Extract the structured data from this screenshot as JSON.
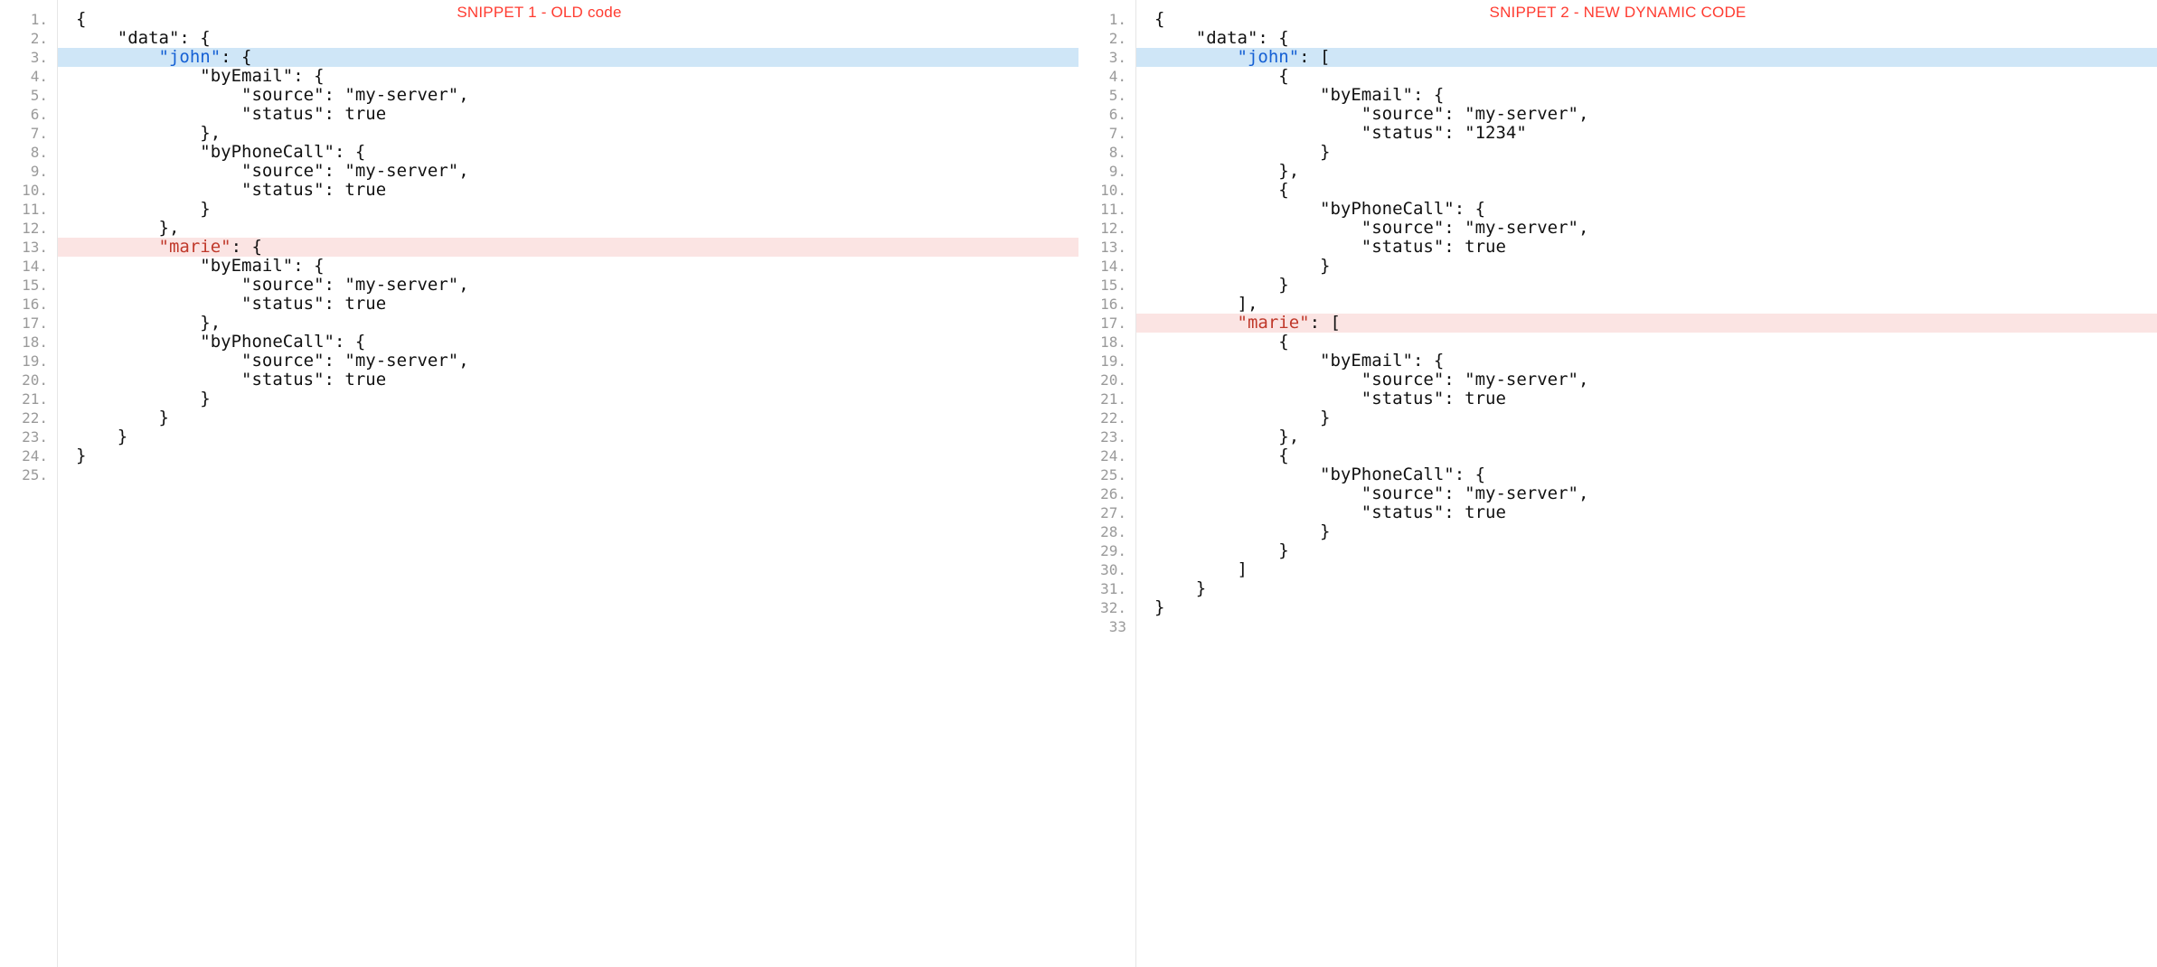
{
  "left": {
    "title": "SNIPPET 1 - OLD code",
    "lines": [
      {
        "n": "1.",
        "hl": "",
        "segs": [
          {
            "cls": "",
            "t": "{"
          }
        ]
      },
      {
        "n": "2.",
        "hl": "",
        "segs": [
          {
            "cls": "",
            "t": "    \"data\": {"
          }
        ]
      },
      {
        "n": "3.",
        "hl": "blue",
        "segs": [
          {
            "cls": "",
            "t": "        "
          },
          {
            "cls": "tok-key-blue",
            "t": "\"john\""
          },
          {
            "cls": "",
            "t": ": {"
          }
        ]
      },
      {
        "n": "4.",
        "hl": "",
        "segs": [
          {
            "cls": "",
            "t": "            \"byEmail\": {"
          }
        ]
      },
      {
        "n": "5.",
        "hl": "",
        "segs": [
          {
            "cls": "",
            "t": "                \"source\": \"my-server\","
          }
        ]
      },
      {
        "n": "6.",
        "hl": "",
        "segs": [
          {
            "cls": "",
            "t": "                \"status\": true"
          }
        ]
      },
      {
        "n": "7.",
        "hl": "",
        "segs": [
          {
            "cls": "",
            "t": "            },"
          }
        ]
      },
      {
        "n": "8.",
        "hl": "",
        "segs": [
          {
            "cls": "",
            "t": "            \"byPhoneCall\": {"
          }
        ]
      },
      {
        "n": "9.",
        "hl": "",
        "segs": [
          {
            "cls": "",
            "t": "                \"source\": \"my-server\","
          }
        ]
      },
      {
        "n": "10.",
        "hl": "",
        "segs": [
          {
            "cls": "",
            "t": "                \"status\": true"
          }
        ]
      },
      {
        "n": "11.",
        "hl": "",
        "segs": [
          {
            "cls": "",
            "t": "            }"
          }
        ]
      },
      {
        "n": "12.",
        "hl": "",
        "segs": [
          {
            "cls": "",
            "t": "        },"
          }
        ]
      },
      {
        "n": "13.",
        "hl": "pink",
        "segs": [
          {
            "cls": "",
            "t": "        "
          },
          {
            "cls": "tok-key-red",
            "t": "\"marie\""
          },
          {
            "cls": "",
            "t": ": {"
          }
        ]
      },
      {
        "n": "14.",
        "hl": "",
        "segs": [
          {
            "cls": "",
            "t": "            \"byEmail\": {"
          }
        ]
      },
      {
        "n": "15.",
        "hl": "",
        "segs": [
          {
            "cls": "",
            "t": "                \"source\": \"my-server\","
          }
        ]
      },
      {
        "n": "16.",
        "hl": "",
        "segs": [
          {
            "cls": "",
            "t": "                \"status\": true"
          }
        ]
      },
      {
        "n": "17.",
        "hl": "",
        "segs": [
          {
            "cls": "",
            "t": "            },"
          }
        ]
      },
      {
        "n": "18.",
        "hl": "",
        "segs": [
          {
            "cls": "",
            "t": "            \"byPhoneCall\": {"
          }
        ]
      },
      {
        "n": "19.",
        "hl": "",
        "segs": [
          {
            "cls": "",
            "t": "                \"source\": \"my-server\","
          }
        ]
      },
      {
        "n": "20.",
        "hl": "",
        "segs": [
          {
            "cls": "",
            "t": "                \"status\": true"
          }
        ]
      },
      {
        "n": "21.",
        "hl": "",
        "segs": [
          {
            "cls": "",
            "t": "            }"
          }
        ]
      },
      {
        "n": "22.",
        "hl": "",
        "segs": [
          {
            "cls": "",
            "t": "        }"
          }
        ]
      },
      {
        "n": "23.",
        "hl": "",
        "segs": [
          {
            "cls": "",
            "t": "    }"
          }
        ]
      },
      {
        "n": "24.",
        "hl": "",
        "segs": [
          {
            "cls": "",
            "t": "}"
          }
        ]
      },
      {
        "n": "25.",
        "hl": "",
        "segs": [
          {
            "cls": "",
            "t": ""
          }
        ]
      }
    ]
  },
  "right": {
    "title": "SNIPPET 2 - NEW DYNAMIC CODE",
    "lines": [
      {
        "n": "1.",
        "hl": "",
        "segs": [
          {
            "cls": "",
            "t": "{"
          }
        ]
      },
      {
        "n": "2.",
        "hl": "",
        "segs": [
          {
            "cls": "",
            "t": "    \"data\": {"
          }
        ]
      },
      {
        "n": "3.",
        "hl": "blue",
        "segs": [
          {
            "cls": "",
            "t": "        "
          },
          {
            "cls": "tok-key-blue",
            "t": "\"john\""
          },
          {
            "cls": "",
            "t": ": ["
          }
        ]
      },
      {
        "n": "4.",
        "hl": "",
        "segs": [
          {
            "cls": "",
            "t": "            {"
          }
        ]
      },
      {
        "n": "5.",
        "hl": "",
        "segs": [
          {
            "cls": "",
            "t": "                \"byEmail\": {"
          }
        ]
      },
      {
        "n": "6.",
        "hl": "",
        "segs": [
          {
            "cls": "",
            "t": "                    \"source\": \"my-server\","
          }
        ]
      },
      {
        "n": "7.",
        "hl": "",
        "segs": [
          {
            "cls": "",
            "t": "                    \"status\": \"1234\""
          }
        ]
      },
      {
        "n": "8.",
        "hl": "",
        "segs": [
          {
            "cls": "",
            "t": "                }"
          }
        ]
      },
      {
        "n": "9.",
        "hl": "",
        "segs": [
          {
            "cls": "",
            "t": "            },"
          }
        ]
      },
      {
        "n": "10.",
        "hl": "",
        "segs": [
          {
            "cls": "",
            "t": "            {"
          }
        ]
      },
      {
        "n": "11.",
        "hl": "",
        "segs": [
          {
            "cls": "",
            "t": "                \"byPhoneCall\": {"
          }
        ]
      },
      {
        "n": "12.",
        "hl": "",
        "segs": [
          {
            "cls": "",
            "t": "                    \"source\": \"my-server\","
          }
        ]
      },
      {
        "n": "13.",
        "hl": "",
        "segs": [
          {
            "cls": "",
            "t": "                    \"status\": true"
          }
        ]
      },
      {
        "n": "14.",
        "hl": "",
        "segs": [
          {
            "cls": "",
            "t": "                }"
          }
        ]
      },
      {
        "n": "15.",
        "hl": "",
        "segs": [
          {
            "cls": "",
            "t": "            }"
          }
        ]
      },
      {
        "n": "16.",
        "hl": "",
        "segs": [
          {
            "cls": "",
            "t": "        ],"
          }
        ]
      },
      {
        "n": "17.",
        "hl": "pink",
        "segs": [
          {
            "cls": "",
            "t": "        "
          },
          {
            "cls": "tok-key-red",
            "t": "\"marie\""
          },
          {
            "cls": "",
            "t": ": ["
          }
        ]
      },
      {
        "n": "18.",
        "hl": "",
        "segs": [
          {
            "cls": "",
            "t": "            {"
          }
        ]
      },
      {
        "n": "19.",
        "hl": "",
        "segs": [
          {
            "cls": "",
            "t": "                \"byEmail\": {"
          }
        ]
      },
      {
        "n": "20.",
        "hl": "",
        "segs": [
          {
            "cls": "",
            "t": "                    \"source\": \"my-server\","
          }
        ]
      },
      {
        "n": "21.",
        "hl": "",
        "segs": [
          {
            "cls": "",
            "t": "                    \"status\": true"
          }
        ]
      },
      {
        "n": "22.",
        "hl": "",
        "segs": [
          {
            "cls": "",
            "t": "                }"
          }
        ]
      },
      {
        "n": "23.",
        "hl": "",
        "segs": [
          {
            "cls": "",
            "t": "            },"
          }
        ]
      },
      {
        "n": "24.",
        "hl": "",
        "segs": [
          {
            "cls": "",
            "t": "            {"
          }
        ]
      },
      {
        "n": "25.",
        "hl": "",
        "segs": [
          {
            "cls": "",
            "t": "                \"byPhoneCall\": {"
          }
        ]
      },
      {
        "n": "26.",
        "hl": "",
        "segs": [
          {
            "cls": "",
            "t": "                    \"source\": \"my-server\","
          }
        ]
      },
      {
        "n": "27.",
        "hl": "",
        "segs": [
          {
            "cls": "",
            "t": "                    \"status\": true"
          }
        ]
      },
      {
        "n": "28.",
        "hl": "",
        "segs": [
          {
            "cls": "",
            "t": "                }"
          }
        ]
      },
      {
        "n": "29.",
        "hl": "",
        "segs": [
          {
            "cls": "",
            "t": "            }"
          }
        ]
      },
      {
        "n": "30.",
        "hl": "",
        "segs": [
          {
            "cls": "",
            "t": "        ]"
          }
        ]
      },
      {
        "n": "31.",
        "hl": "",
        "segs": [
          {
            "cls": "",
            "t": "    }"
          }
        ]
      },
      {
        "n": "32.",
        "hl": "",
        "segs": [
          {
            "cls": "",
            "t": "}"
          }
        ]
      },
      {
        "n": "33",
        "hl": "",
        "segs": [
          {
            "cls": "",
            "t": ""
          }
        ]
      }
    ]
  }
}
